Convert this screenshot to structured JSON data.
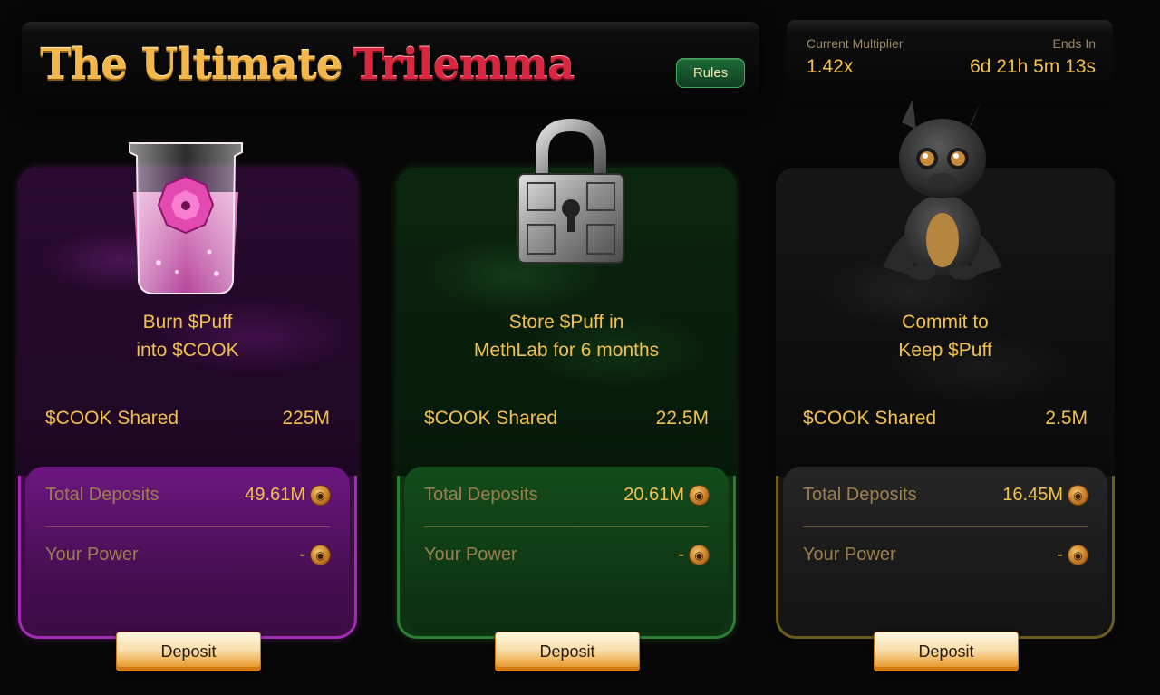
{
  "header": {
    "title_part1": "The Ultimate",
    "title_part2": "Trilemma",
    "rules_label": "Rules"
  },
  "stats": {
    "multiplier_label": "Current Multiplier",
    "multiplier_value": "1.42x",
    "ends_label": "Ends In",
    "ends_value": "6d 21h 5m 13s"
  },
  "cards": [
    {
      "theme": "purple",
      "illustration": "beaker-icon",
      "title_line1": "Burn $Puff",
      "title_line2": "into $COOK",
      "shared_label": "$COOK Shared",
      "shared_value": "225M",
      "deposits_label": "Total Deposits",
      "deposits_value": "49.61M",
      "power_label": "Your Power",
      "power_value": "-",
      "deposit_button": "Deposit"
    },
    {
      "theme": "green",
      "illustration": "padlock-icon",
      "title_line1": "Store $Puff in",
      "title_line2": "MethLab for 6 months",
      "shared_label": "$COOK Shared",
      "shared_value": "22.5M",
      "deposits_label": "Total Deposits",
      "deposits_value": "20.61M",
      "power_label": "Your Power",
      "power_value": "-",
      "deposit_button": "Deposit"
    },
    {
      "theme": "dark",
      "illustration": "dragon-icon",
      "title_line1": "Commit to",
      "title_line2": "Keep $Puff",
      "shared_label": "$COOK Shared",
      "shared_value": "2.5M",
      "deposits_label": "Total Deposits",
      "deposits_value": "16.45M",
      "power_label": "Your Power",
      "power_value": "-",
      "deposit_button": "Deposit"
    }
  ],
  "colors": {
    "gold_text": "#f2c04e",
    "purple_accent": "#a22cb4",
    "green_accent": "#2d7d35",
    "rules_green": "#1e6a38"
  }
}
